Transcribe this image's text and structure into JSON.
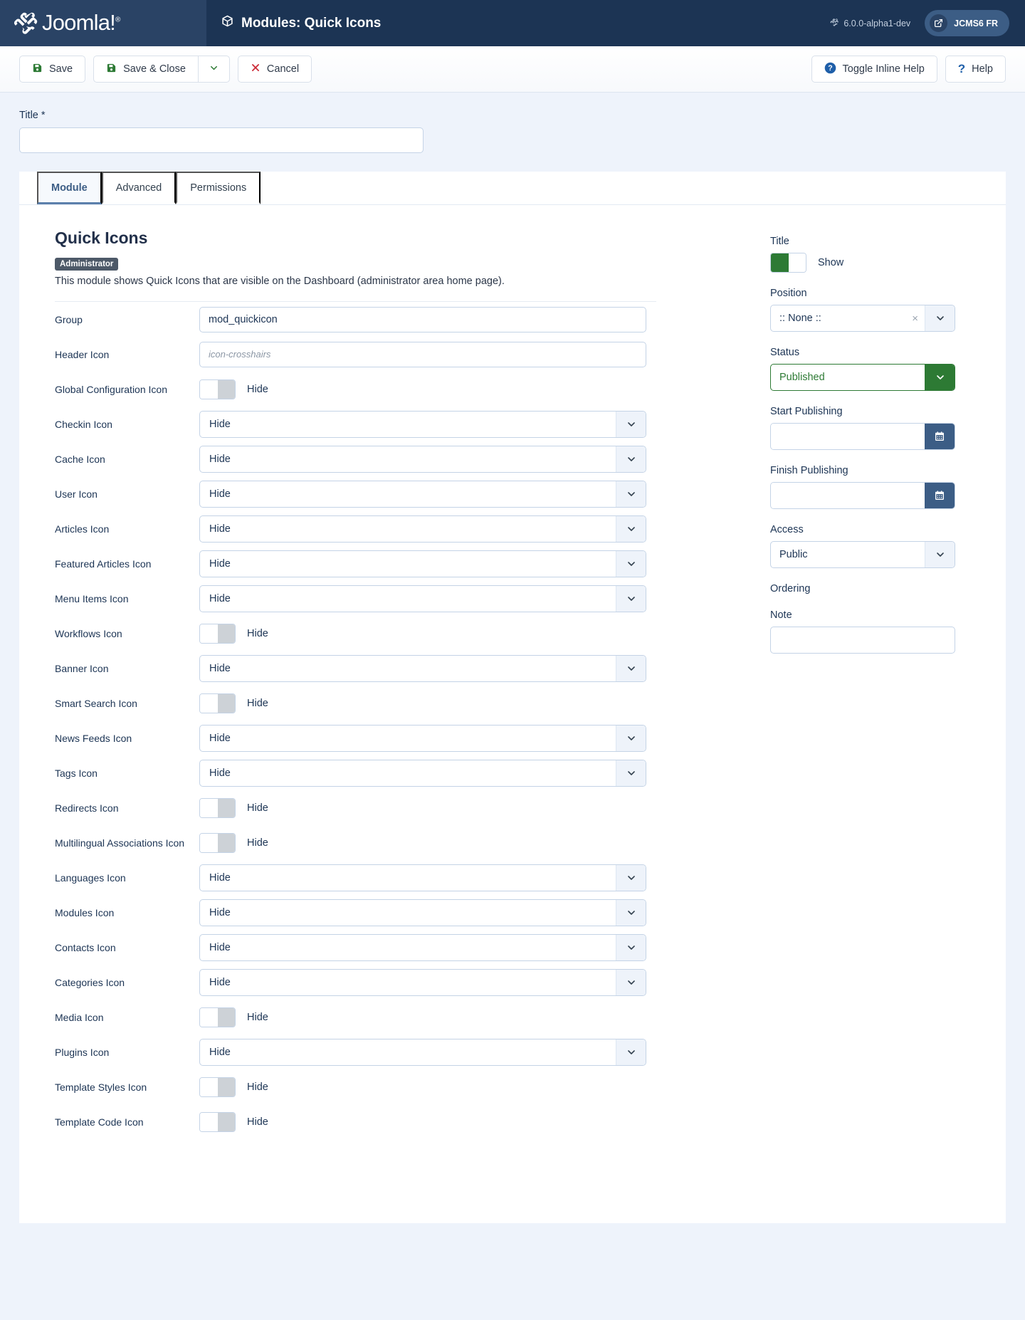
{
  "header": {
    "brand": "Joomla!",
    "brand_sup": "®",
    "page_title": "Modules: Quick Icons",
    "page_icon": "cube-icon",
    "version": "6.0.0-alpha1-dev",
    "version_icon": "joomla-mark-icon",
    "site_pill": "JCMS6 FR",
    "site_pill_icon": "external-link-icon"
  },
  "toolbar": {
    "save": "Save",
    "save_close": "Save & Close",
    "caret_icon": "chevron-down-icon",
    "cancel": "Cancel",
    "toggle_inline_help": "Toggle Inline Help",
    "help": "Help",
    "save_icon": "floppy-disk-icon",
    "cancel_icon": "x-icon",
    "help_icon": "question-mark-icon",
    "info_icon": "question-circle-icon"
  },
  "title_field": {
    "label": "Title *",
    "value": "",
    "placeholder": ""
  },
  "tabs": [
    {
      "label": "Module",
      "active": true
    },
    {
      "label": "Advanced",
      "active": false
    },
    {
      "label": "Permissions",
      "active": false
    }
  ],
  "module": {
    "heading": "Quick Icons",
    "badge": "Administrator",
    "description": "This module shows Quick Icons that are visible on the Dashboard (administrator area home page)."
  },
  "fields": [
    {
      "label": "Group",
      "type": "text",
      "value": "mod_quickicon",
      "placeholder": ""
    },
    {
      "label": "Header Icon",
      "type": "text",
      "value": "",
      "placeholder": "icon-crosshairs"
    },
    {
      "label": "Global Configuration Icon",
      "type": "switch",
      "state": "off",
      "value": "Hide"
    },
    {
      "label": "Checkin Icon",
      "type": "select",
      "value": "Hide"
    },
    {
      "label": "Cache Icon",
      "type": "select",
      "value": "Hide"
    },
    {
      "label": "User Icon",
      "type": "select",
      "value": "Hide"
    },
    {
      "label": "Articles Icon",
      "type": "select",
      "value": "Hide"
    },
    {
      "label": "Featured Articles Icon",
      "type": "select",
      "value": "Hide"
    },
    {
      "label": "Menu Items Icon",
      "type": "select",
      "value": "Hide"
    },
    {
      "label": "Workflows Icon",
      "type": "switch",
      "state": "off",
      "value": "Hide"
    },
    {
      "label": "Banner Icon",
      "type": "select",
      "value": "Hide"
    },
    {
      "label": "Smart Search Icon",
      "type": "switch",
      "state": "off",
      "value": "Hide"
    },
    {
      "label": "News Feeds Icon",
      "type": "select",
      "value": "Hide"
    },
    {
      "label": "Tags Icon",
      "type": "select",
      "value": "Hide"
    },
    {
      "label": "Redirects Icon",
      "type": "switch",
      "state": "off",
      "value": "Hide"
    },
    {
      "label": "Multilingual Associations Icon",
      "type": "switch",
      "state": "off",
      "value": "Hide"
    },
    {
      "label": "Languages Icon",
      "type": "select",
      "value": "Hide"
    },
    {
      "label": "Modules Icon",
      "type": "select",
      "value": "Hide"
    },
    {
      "label": "Contacts Icon",
      "type": "select",
      "value": "Hide"
    },
    {
      "label": "Categories Icon",
      "type": "select",
      "value": "Hide"
    },
    {
      "label": "Media Icon",
      "type": "switch",
      "state": "off",
      "value": "Hide"
    },
    {
      "label": "Plugins Icon",
      "type": "select",
      "value": "Hide"
    },
    {
      "label": "Template Styles Icon",
      "type": "switch",
      "state": "off",
      "value": "Hide"
    },
    {
      "label": "Template Code Icon",
      "type": "switch",
      "state": "off",
      "value": "Hide"
    }
  ],
  "sidebar": {
    "title_label": "Title",
    "title_toggle_state": "on",
    "title_toggle_text": "Show",
    "position_label": "Position",
    "position_value": ":: None ::",
    "position_clear_icon": "close-x-icon",
    "status_label": "Status",
    "status_value": "Published",
    "start_publishing_label": "Start Publishing",
    "start_publishing_value": "",
    "finish_publishing_label": "Finish Publishing",
    "finish_publishing_value": "",
    "calendar_icon": "calendar-icon",
    "access_label": "Access",
    "access_value": "Public",
    "ordering_label": "Ordering",
    "note_label": "Note",
    "note_value": ""
  },
  "colors": {
    "header_bg": "#1c3454",
    "brand_bg": "#2a4365",
    "accent_blue": "#3c5d85",
    "green": "#2d7a34",
    "red": "#cc2936",
    "page_bg": "#eef3fb"
  }
}
